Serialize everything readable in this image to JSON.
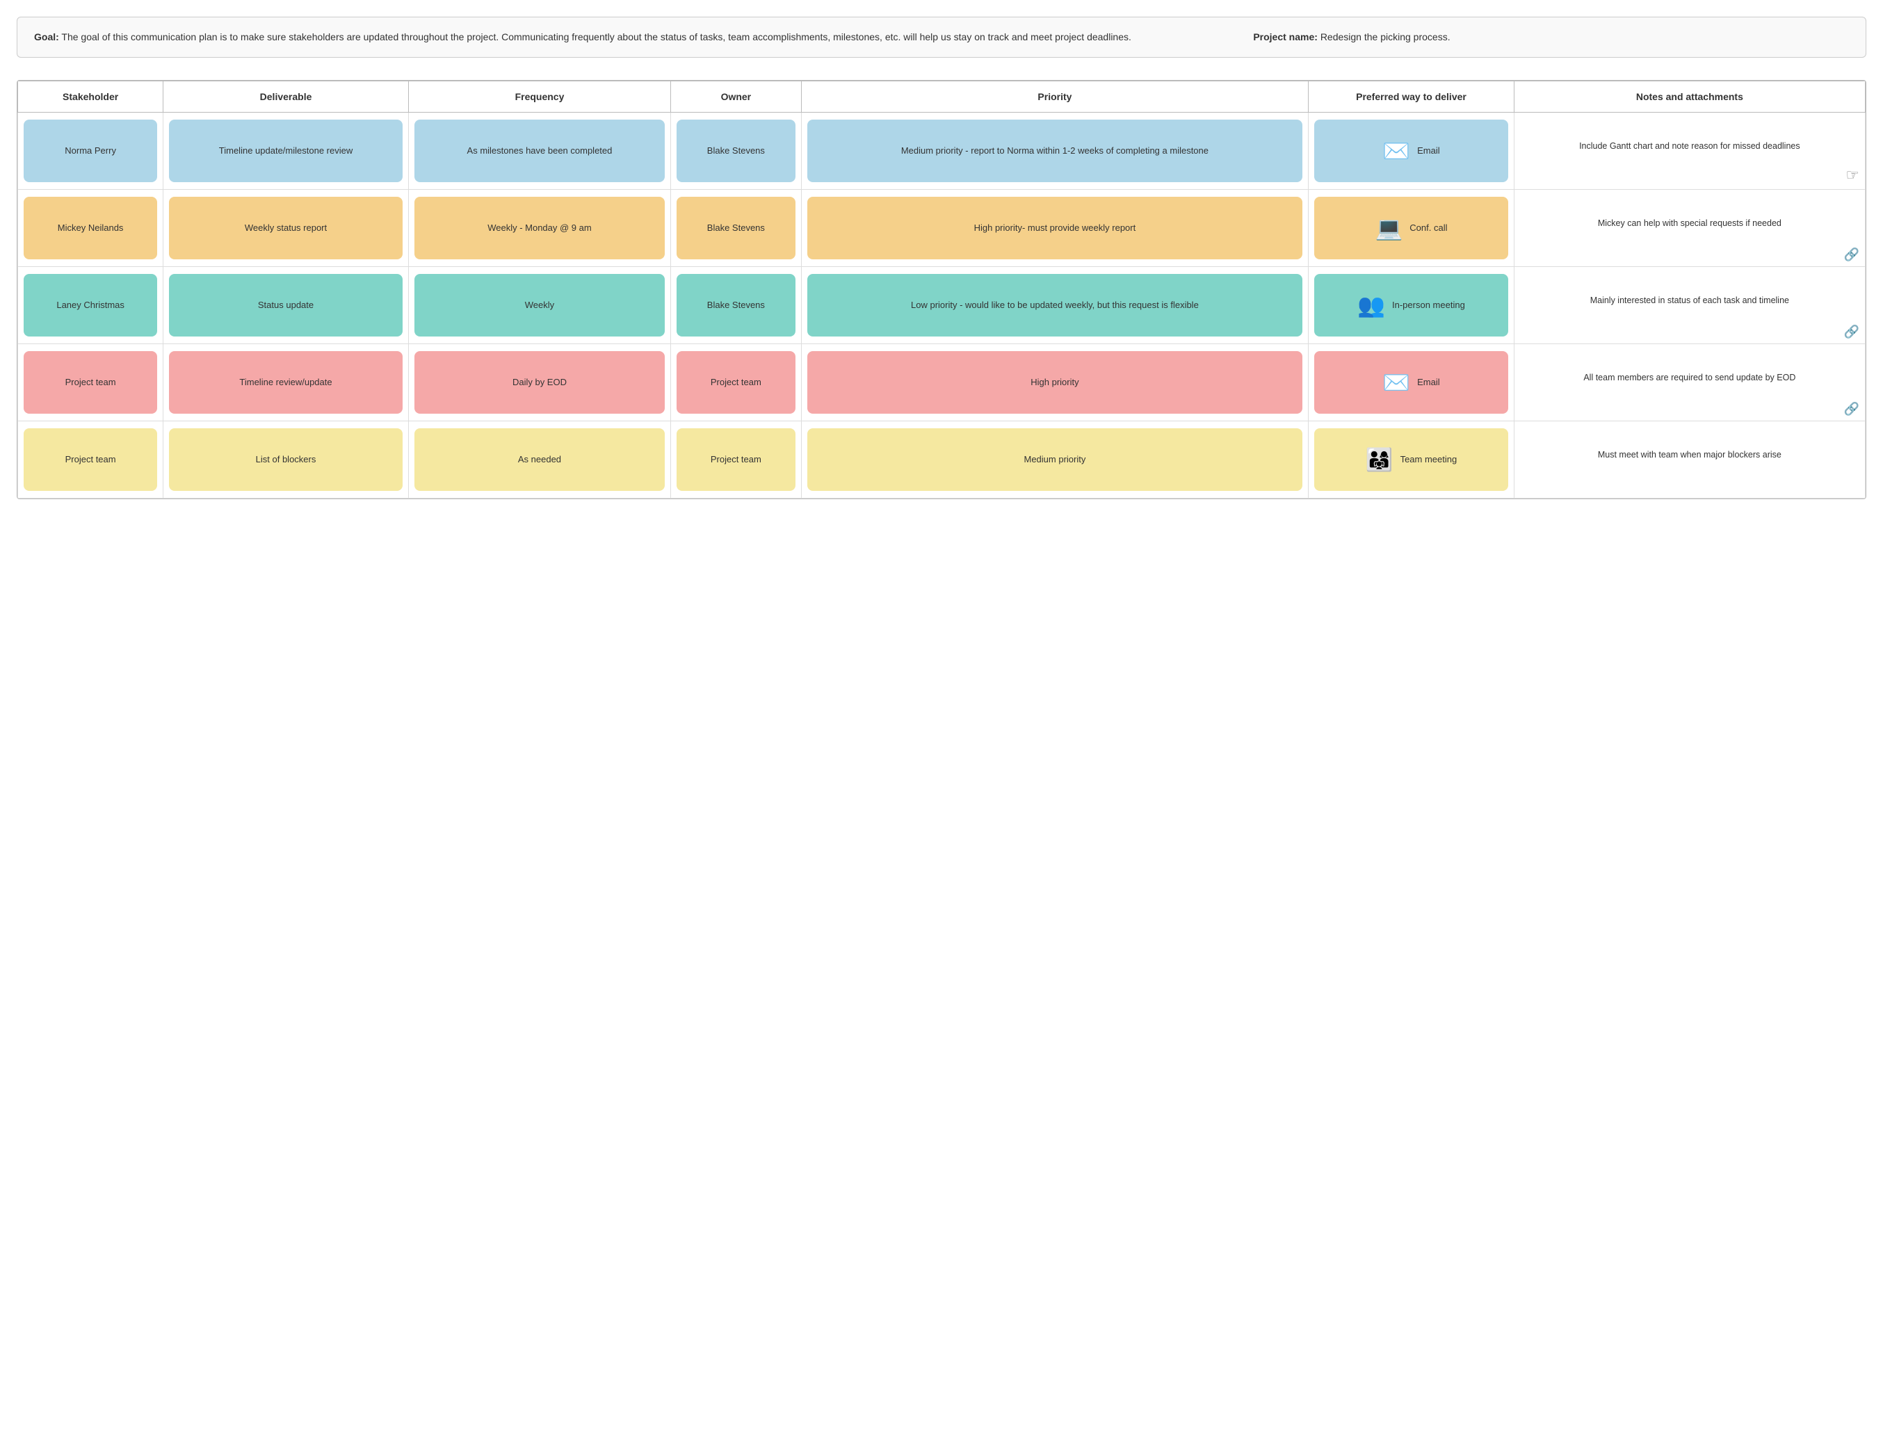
{
  "goal": {
    "label": "Goal:",
    "text": "The goal of this communication plan is to make sure stakeholders are updated throughout the project. Communicating frequently about the status of tasks, team accomplishments, milestones, etc. will help us stay on track and meet project deadlines.",
    "project_label": "Project name:",
    "project_value": "Redesign the picking process."
  },
  "table": {
    "headers": [
      "Stakeholder",
      "Deliverable",
      "Frequency",
      "Owner",
      "Priority",
      "Preferred way to deliver",
      "Notes and attachments"
    ],
    "rows": [
      {
        "color": "blue",
        "stakeholder": "Norma Perry",
        "deliverable": "Timeline update/milestone review",
        "frequency": "As milestones have been completed",
        "owner": "Blake Stevens",
        "priority": "Medium priority - report to Norma within 1-2 weeks of completing a milestone",
        "deliver_icon": "✉",
        "deliver_label": "Email",
        "notes": "Include Gantt chart and note reason for missed deadlines",
        "notes_icon": "hand"
      },
      {
        "color": "orange",
        "stakeholder": "Mickey Neilands",
        "deliverable": "Weekly status report",
        "frequency": "Weekly - Monday @ 9 am",
        "owner": "Blake Stevens",
        "priority": "High priority- must provide weekly report",
        "deliver_icon": "💻",
        "deliver_label": "Conf. call",
        "notes": "Mickey can help with special requests if needed",
        "notes_icon": "link"
      },
      {
        "color": "teal",
        "stakeholder": "Laney Christmas",
        "deliverable": "Status update",
        "frequency": "Weekly",
        "owner": "Blake Stevens",
        "priority": "Low priority - would like to be updated weekly, but this request is flexible",
        "deliver_icon": "👥",
        "deliver_label": "In-person meeting",
        "notes": "Mainly interested in status of each task and timeline",
        "notes_icon": "link"
      },
      {
        "color": "pink",
        "stakeholder": "Project team",
        "deliverable": "Timeline review/update",
        "frequency": "Daily by EOD",
        "owner": "Project team",
        "priority": "High priority",
        "deliver_icon": "✉",
        "deliver_label": "Email",
        "notes": "All team members are required to send update by EOD",
        "notes_icon": "link"
      },
      {
        "color": "yellow",
        "stakeholder": "Project team",
        "deliverable": "List of blockers",
        "frequency": "As needed",
        "owner": "Project team",
        "priority": "Medium priority",
        "deliver_icon": "👥👥",
        "deliver_label": "Team meeting",
        "notes": "Must meet with team when major blockers arise",
        "notes_icon": "none"
      }
    ]
  }
}
